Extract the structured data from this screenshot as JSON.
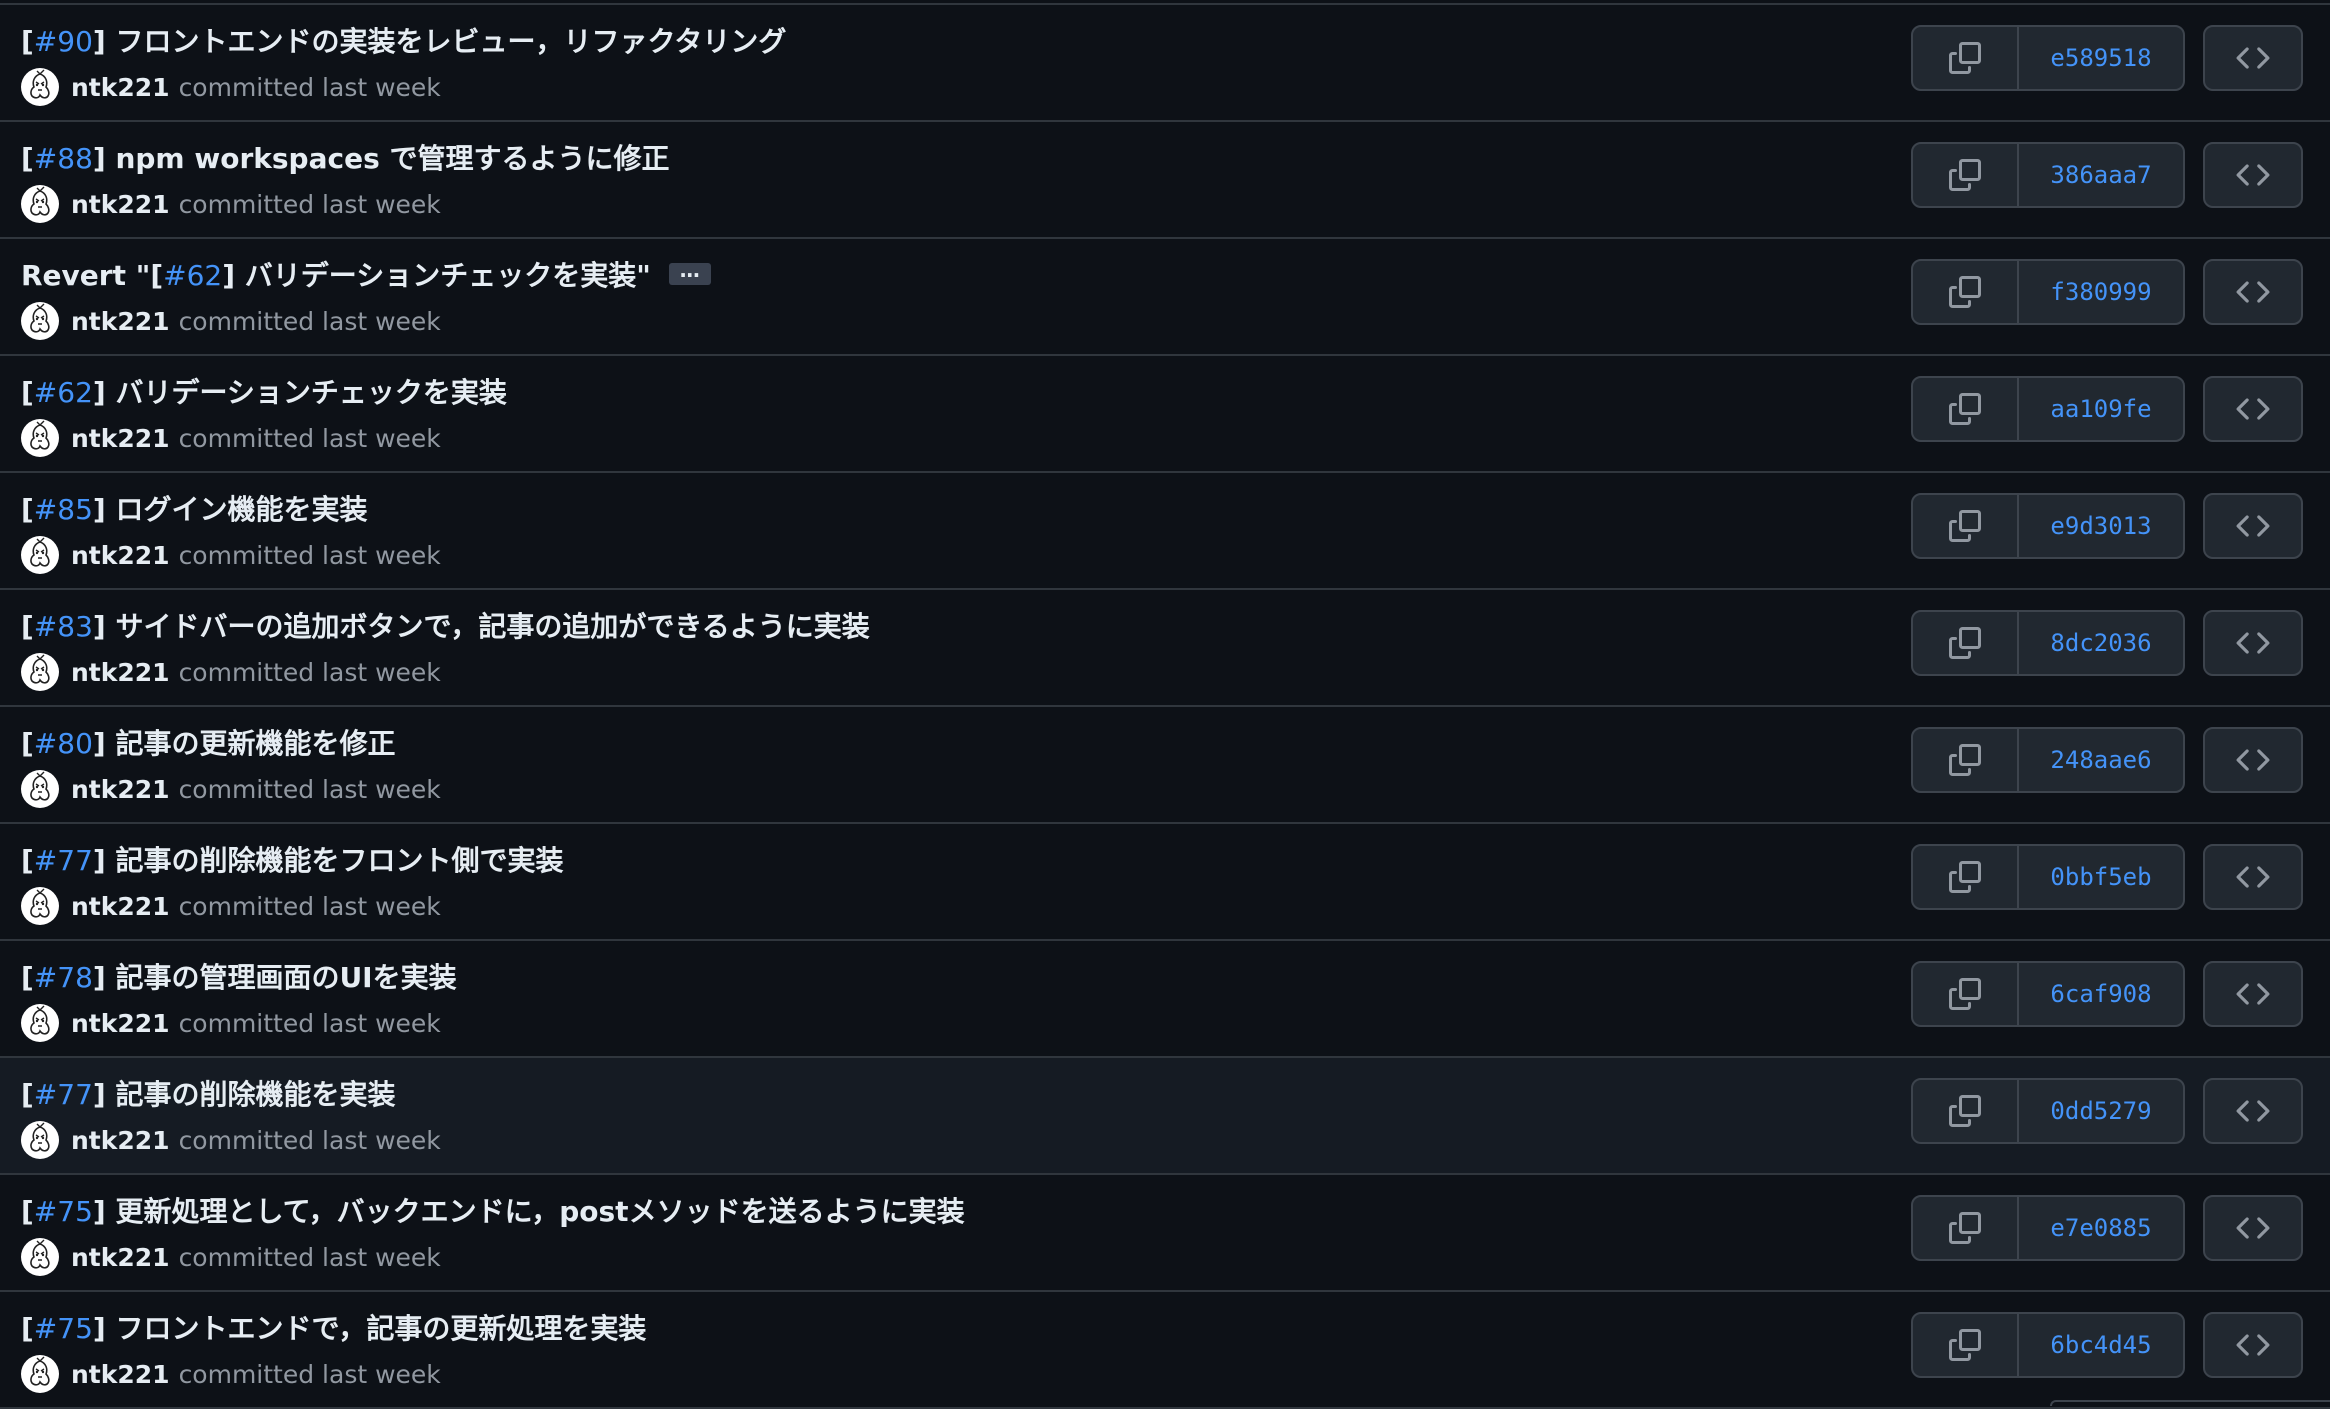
{
  "commits": [
    {
      "issue": "#90",
      "prefix": "",
      "title": "フロントエンドの実装をレビュー，リファクタリング",
      "suffix": "",
      "author": "ntk221",
      "committed": "committed last week",
      "sha": "e589518",
      "highlight": false
    },
    {
      "issue": "#88",
      "prefix": "",
      "title": "npm workspaces で管理するように修正",
      "suffix": "",
      "author": "ntk221",
      "committed": "committed last week",
      "sha": "386aaa7",
      "highlight": false
    },
    {
      "issue": "#62",
      "prefix": "Revert \"",
      "title": "バリデーションチェックを実装\"",
      "suffix": "…",
      "author": "ntk221",
      "committed": "committed last week",
      "sha": "f380999",
      "highlight": false
    },
    {
      "issue": "#62",
      "prefix": "",
      "title": "バリデーションチェックを実装",
      "suffix": "",
      "author": "ntk221",
      "committed": "committed last week",
      "sha": "aa109fe",
      "highlight": false
    },
    {
      "issue": "#85",
      "prefix": "",
      "title": "ログイン機能を実装",
      "suffix": "",
      "author": "ntk221",
      "committed": "committed last week",
      "sha": "e9d3013",
      "highlight": false
    },
    {
      "issue": "#83",
      "prefix": "",
      "title": "サイドバーの追加ボタンで，記事の追加ができるように実装",
      "suffix": "",
      "author": "ntk221",
      "committed": "committed last week",
      "sha": "8dc2036",
      "highlight": false
    },
    {
      "issue": "#80",
      "prefix": "",
      "title": "記事の更新機能を修正",
      "suffix": "",
      "author": "ntk221",
      "committed": "committed last week",
      "sha": "248aae6",
      "highlight": false
    },
    {
      "issue": "#77",
      "prefix": "",
      "title": "記事の削除機能をフロント側で実装",
      "suffix": "",
      "author": "ntk221",
      "committed": "committed last week",
      "sha": "0bbf5eb",
      "highlight": false
    },
    {
      "issue": "#78",
      "prefix": "",
      "title": "記事の管理画面のUIを実装",
      "suffix": "",
      "author": "ntk221",
      "committed": "committed last week",
      "sha": "6caf908",
      "highlight": false
    },
    {
      "issue": "#77",
      "prefix": "",
      "title": "記事の削除機能を実装",
      "suffix": "",
      "author": "ntk221",
      "committed": "committed last week",
      "sha": "0dd5279",
      "highlight": true
    },
    {
      "issue": "#75",
      "prefix": "",
      "title": "更新処理として，バックエンドに，postメソッドを送るように実装",
      "suffix": "",
      "author": "ntk221",
      "committed": "committed last week",
      "sha": "e7e0885",
      "highlight": false
    },
    {
      "issue": "#75",
      "prefix": "",
      "title": "フロントエンドで，記事の更新処理を実装",
      "suffix": "",
      "author": "ntk221",
      "committed": "committed last week",
      "sha": "6bc4d45",
      "highlight": false
    }
  ],
  "icons": {
    "copy": "copy-icon",
    "browse": "code-brackets-icon",
    "avatar": "avatar-image"
  },
  "colors": {
    "background": "#0d1117",
    "link": "#4493f8",
    "muted": "#9198a1",
    "border": "#30363d",
    "button": "#212830"
  }
}
